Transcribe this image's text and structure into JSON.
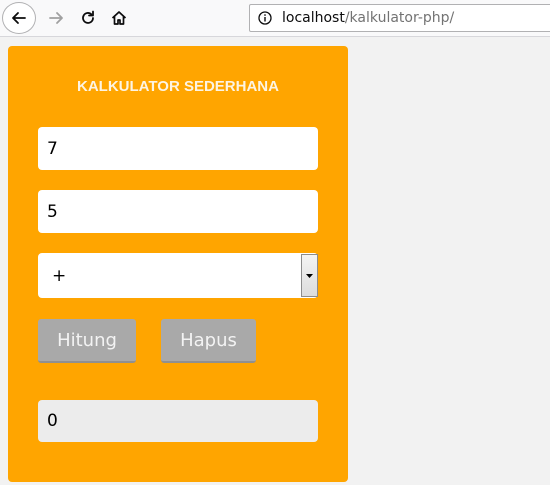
{
  "browser": {
    "url_host": "localhost",
    "url_path": "/kalkulator-php/"
  },
  "calculator": {
    "title": "KALKULATOR SEDERHANA",
    "angka1": "7",
    "angka2": "5",
    "operator": "+",
    "hitung_label": "Hitung",
    "hapus_label": "Hapus",
    "hasil": "0"
  },
  "colors": {
    "panel": "#ffa500",
    "button": "#a9a9a9"
  }
}
